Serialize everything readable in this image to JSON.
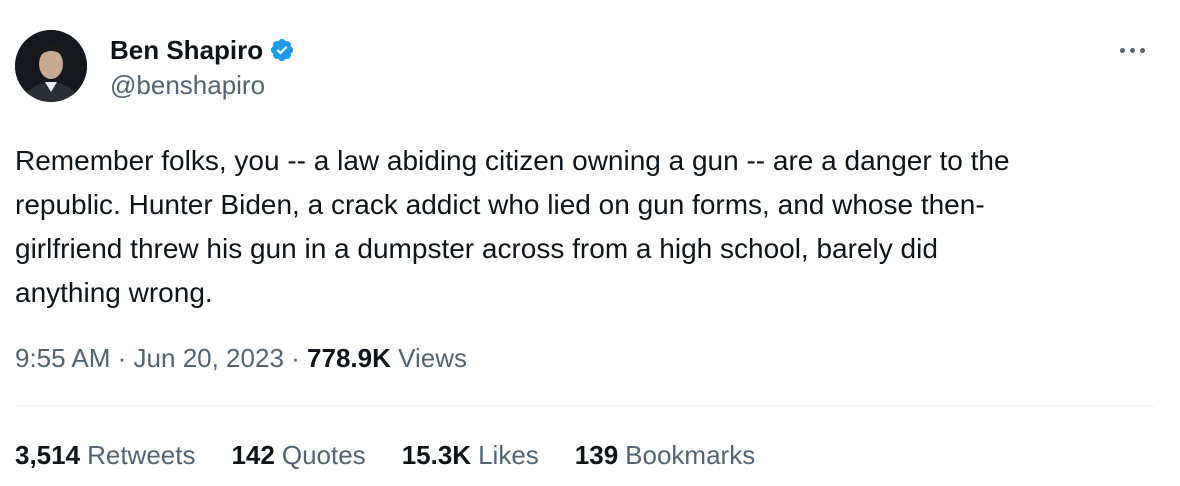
{
  "author": {
    "display_name": "Ben Shapiro",
    "handle": "@benshapiro",
    "verified": true,
    "verified_color": "#1d9bf0"
  },
  "tweet": {
    "text": "Remember folks, you -- a law abiding citizen owning a gun -- are a danger to the\nrepublic. Hunter Biden, a crack addict who lied on gun forms, and whose then-\ngirlfriend threw his gun in a dumpster across from a high school, barely did\nanything wrong."
  },
  "meta": {
    "time": "9:55 AM",
    "separator": "·",
    "date": "Jun 20, 2023",
    "views_count": "778.9K",
    "views_label": "Views"
  },
  "stats": [
    {
      "count": "3,514",
      "label": "Retweets"
    },
    {
      "count": "142",
      "label": "Quotes"
    },
    {
      "count": "15.3K",
      "label": "Likes"
    },
    {
      "count": "139",
      "label": "Bookmarks"
    }
  ],
  "icons": {
    "more": "more-horizontal-icon",
    "verified": "verified-badge-icon"
  },
  "colors": {
    "text_primary": "#0f1419",
    "text_secondary": "#536471",
    "divider": "#eff3f4"
  }
}
